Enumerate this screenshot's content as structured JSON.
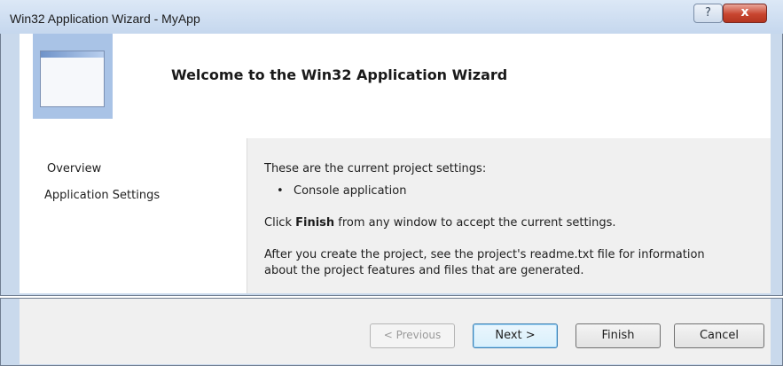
{
  "window": {
    "title": "Win32 Application Wizard - MyApp",
    "help_label": "?",
    "close_label": "x"
  },
  "header": {
    "heading": "Welcome to the Win32 Application Wizard"
  },
  "nav": {
    "items": [
      {
        "label": "Overview"
      },
      {
        "label": "Application Settings"
      }
    ]
  },
  "content": {
    "intro": "These are the current project settings:",
    "bullet_char": "•",
    "settings": [
      "Console application"
    ],
    "finish_prefix": "Click ",
    "finish_bold": "Finish",
    "finish_suffix": " from any window to accept the current settings.",
    "readme_line1": "After you create the project, see the project's readme.txt file for information",
    "readme_line2": "about the project features and files that are generated."
  },
  "buttons": {
    "previous": "< Previous",
    "next": "Next >",
    "finish": "Finish",
    "cancel": "Cancel"
  }
}
